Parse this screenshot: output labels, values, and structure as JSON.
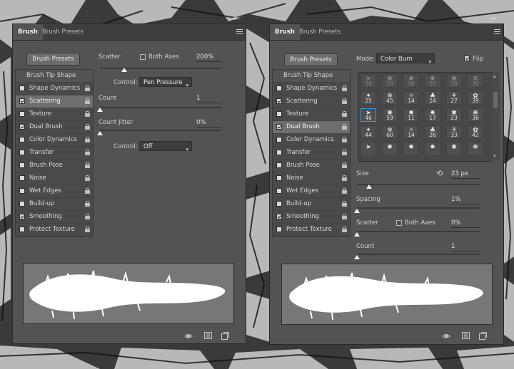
{
  "colors": {
    "panel": "#535353",
    "selection": "#3a9ad9",
    "preview_bg": "#777777"
  },
  "left_panel": {
    "tabs": [
      {
        "label": "Brush"
      },
      {
        "label": "Brush Presets"
      }
    ],
    "presets_button": "Brush Presets",
    "list_title": "Brush Tip Shape",
    "list_items": [
      {
        "label": "Shape Dynamics",
        "checked": false,
        "selected": false
      },
      {
        "label": "Scattering",
        "checked": true,
        "selected": true
      },
      {
        "label": "Texture",
        "checked": false,
        "selected": false
      },
      {
        "label": "Dual Brush",
        "checked": true,
        "selected": false
      },
      {
        "label": "Color Dynamics",
        "checked": false,
        "selected": false
      },
      {
        "label": "Transfer",
        "checked": false,
        "selected": false
      },
      {
        "label": "Brush Pose",
        "checked": false,
        "selected": false
      },
      {
        "label": "Noise",
        "checked": false,
        "selected": false
      },
      {
        "label": "Wet Edges",
        "checked": false,
        "selected": false
      },
      {
        "label": "Build-up",
        "checked": false,
        "selected": false
      },
      {
        "label": "Smoothing",
        "checked": true,
        "selected": false
      },
      {
        "label": "Protect Texture",
        "checked": false,
        "selected": false
      }
    ],
    "scatter_label": "Scatter",
    "both_axes_label": "Both Axes",
    "scatter_value": "200%",
    "control_label": "Control:",
    "control_value": "Pen Pressure",
    "count_label": "Count",
    "count_value": "1",
    "count_jitter_label": "Count Jitter",
    "count_jitter_value": "0%",
    "control2_label": "Control:",
    "control2_value": "Off",
    "scatter_slider_fraction": 0.2,
    "count_slider_fraction": 0.0,
    "count_jitter_slider_fraction": 0.0
  },
  "right_panel": {
    "tabs": [
      {
        "label": "Brush"
      },
      {
        "label": "Brush Presets"
      }
    ],
    "presets_button": "Brush Presets",
    "mode_label": "Mode:",
    "mode_value": "Color Burn",
    "flip_label": "Flip",
    "list_title": "Brush Tip Shape",
    "list_items": [
      {
        "label": "Shape Dynamics",
        "checked": false,
        "selected": false
      },
      {
        "label": "Scattering",
        "checked": true,
        "selected": false
      },
      {
        "label": "Texture",
        "checked": false,
        "selected": false
      },
      {
        "label": "Dual Brush",
        "checked": true,
        "selected": true
      },
      {
        "label": "Color Dynamics",
        "checked": false,
        "selected": false
      },
      {
        "label": "Transfer",
        "checked": false,
        "selected": false
      },
      {
        "label": "Brush Pose",
        "checked": false,
        "selected": false
      },
      {
        "label": "Noise",
        "checked": false,
        "selected": false
      },
      {
        "label": "Wet Edges",
        "checked": false,
        "selected": false
      },
      {
        "label": "Build-up",
        "checked": false,
        "selected": false
      },
      {
        "label": "Smoothing",
        "checked": true,
        "selected": false
      },
      {
        "label": "Protect Texture",
        "checked": false,
        "selected": false
      }
    ],
    "brush_grid_rows": [
      [
        "30",
        "30",
        "30",
        "20",
        "30",
        "30"
      ],
      [
        "25",
        "45",
        "14",
        "24",
        "27",
        "39"
      ],
      [
        "46",
        "59",
        "11",
        "17",
        "23",
        "36"
      ],
      [
        "44",
        "60",
        "14",
        "26",
        "33",
        "42"
      ],
      [
        "",
        "",
        "",
        "",
        "",
        ""
      ]
    ],
    "brush_grid_selected": "46",
    "size_label": "Size",
    "size_value": "23 px",
    "spacing_label": "Spacing",
    "spacing_value": "1%",
    "scatter_label": "Scatter",
    "both_axes_label": "Both Axes",
    "scatter_value": "0%",
    "count_label": "Count",
    "count_value": "1",
    "size_slider_fraction": 0.1,
    "spacing_slider_fraction": 0.0,
    "scatter_slider_fraction": 0.0,
    "count_slider_fraction": 0.0
  },
  "footer_icons": [
    "toggle-preview-icon",
    "grid-icon",
    "new-preset-icon"
  ]
}
